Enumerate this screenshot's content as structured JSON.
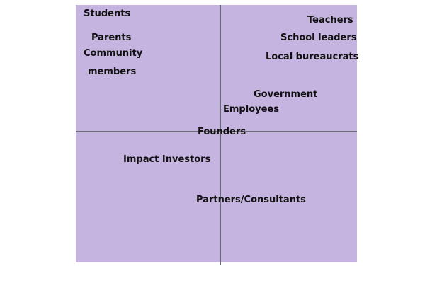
{
  "colors": {
    "panel": "#c5b3e0",
    "axis": "#6b6b7a",
    "text": "#111111"
  },
  "labels": {
    "students": "Students",
    "parents": "Parents",
    "community_line1": "Community",
    "community_line2": "members",
    "teachers": "Teachers",
    "school_leaders": "School leaders",
    "local_bureaucrats": "Local bureaucrats",
    "government": "Government",
    "employees": "Employees",
    "founders": "Founders",
    "impact_investors": "Impact Investors",
    "partners_consultants": "Partners/Consultants"
  }
}
